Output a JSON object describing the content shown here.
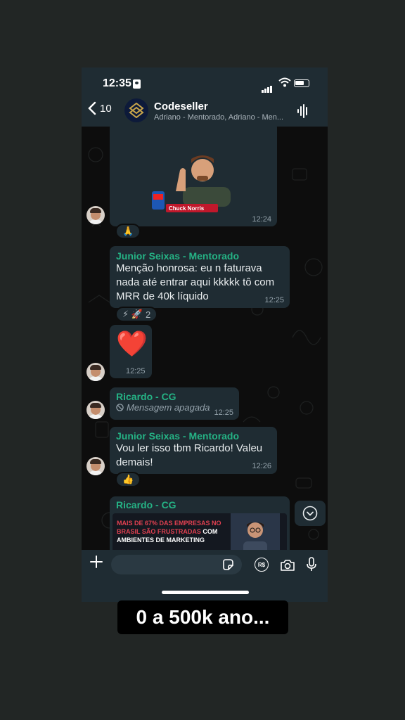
{
  "status_bar": {
    "time": "12:35"
  },
  "header": {
    "back_count": "10",
    "group_name": "Codeseller",
    "participants": "Adriano - Mentorado, Adriano - Men..."
  },
  "messages": [
    {
      "type": "sticker",
      "sticker_caption": "Chuck Norris",
      "time": "12:24",
      "reaction": "🙏"
    },
    {
      "type": "text",
      "sender": "Junior Seixas - Mentorado",
      "lines": [
        "Menção honrosa: eu n faturava",
        "nada até entrar aqui kkkkk tô com",
        "MRR de 40k líquido"
      ],
      "time": "12:25",
      "reaction_emojis": "⚡ 🚀",
      "reaction_count": "2"
    },
    {
      "type": "emoji",
      "emoji": "❤️",
      "time": "12:25"
    },
    {
      "type": "deleted",
      "sender": "Ricardo - CG",
      "text": "Mensagem apagada",
      "time": "12:25"
    },
    {
      "type": "text",
      "sender": "Junior Seixas - Mentorado",
      "lines": [
        "Vou ler isso tbm Ricardo! Valeu",
        "demais!"
      ],
      "time": "12:26",
      "reaction": "👍"
    },
    {
      "type": "image",
      "sender": "Ricardo - CG",
      "banner_line1": "MAIS DE 67% DAS EMPRESAS NO",
      "banner_line2_red": "BRASIL SÃO FRUSTRADAS",
      "banner_line2_white": " COM",
      "banner_line3": "AMBIENTES DE MARKETING"
    }
  ],
  "composer": {
    "placeholder": "",
    "rs_label": "R$"
  },
  "caption": "0 a 500k ano...",
  "colors": {
    "accent": "#25b385",
    "bubble": "#1f2c33",
    "bar": "#1f2c33"
  }
}
